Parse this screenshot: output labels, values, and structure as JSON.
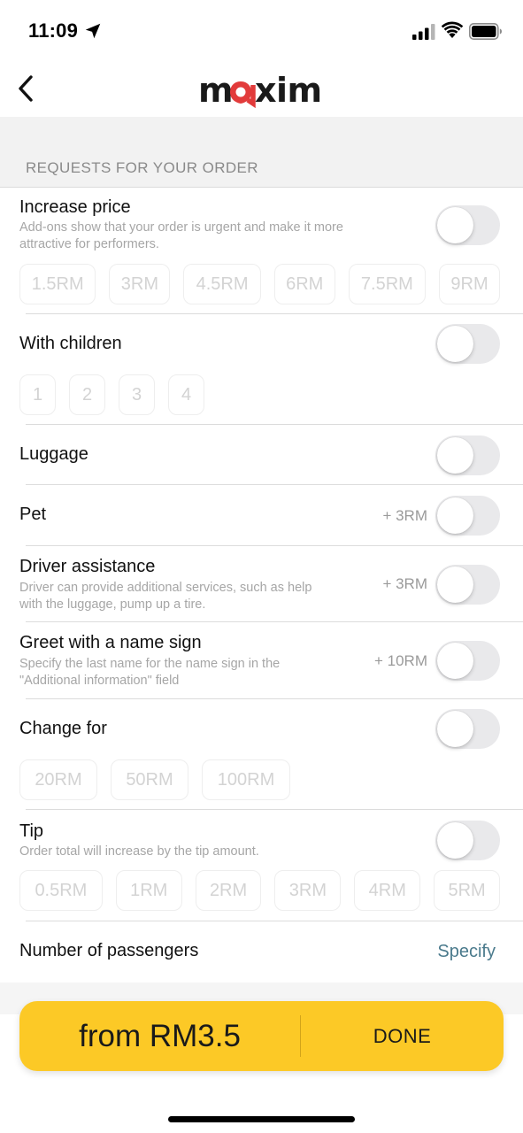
{
  "status_bar": {
    "time": "11:09",
    "icons": [
      "location-arrow-icon",
      "cellular-signal-icon",
      "wifi-icon",
      "battery-icon"
    ]
  },
  "header": {
    "brand": "maxim",
    "brand_color": "#1a1a1a",
    "brand_accent_color": "#e23b3b",
    "back_icon": "chevron-left-icon"
  },
  "section_title": "REQUESTS FOR YOUR ORDER",
  "options": {
    "increase_price": {
      "title": "Increase price",
      "subtitle_line1": "Add-ons show that your order is urgent and make it more",
      "subtitle_line2": "attractive for performers.",
      "enabled": false,
      "chips": [
        "1.5RM",
        "3RM",
        "4.5RM",
        "6RM",
        "7.5RM",
        "9RM"
      ]
    },
    "with_children": {
      "title": "With children",
      "enabled": false,
      "chips": [
        "1",
        "2",
        "3",
        "4"
      ]
    },
    "luggage": {
      "title": "Luggage",
      "enabled": false
    },
    "pet": {
      "title": "Pet",
      "price": "+ 3RM",
      "enabled": false
    },
    "driver_assistance": {
      "title": "Driver assistance",
      "subtitle_line1": "Driver can provide additional services, such as help",
      "subtitle_line2": "with the luggage, pump up a tire.",
      "price": "+ 3RM",
      "enabled": false
    },
    "name_sign": {
      "title": "Greet with a name sign",
      "subtitle_line1": "Specify the last name for the name sign in the",
      "subtitle_line2": "\"Additional information\" field",
      "price": "+ 10RM",
      "enabled": false
    },
    "change_for": {
      "title": "Change for",
      "enabled": false,
      "chips": [
        "20RM",
        "50RM",
        "100RM"
      ]
    },
    "tip": {
      "title": "Tip",
      "subtitle": "Order total will increase by the tip amount.",
      "enabled": false,
      "chips": [
        "0.5RM",
        "1RM",
        "2RM",
        "3RM",
        "4RM",
        "5RM"
      ]
    },
    "passengers": {
      "title": "Number of passengers",
      "action": "Specify"
    }
  },
  "order_button": {
    "price": "from RM3.5",
    "done": "DONE",
    "color": "#fcc926"
  }
}
